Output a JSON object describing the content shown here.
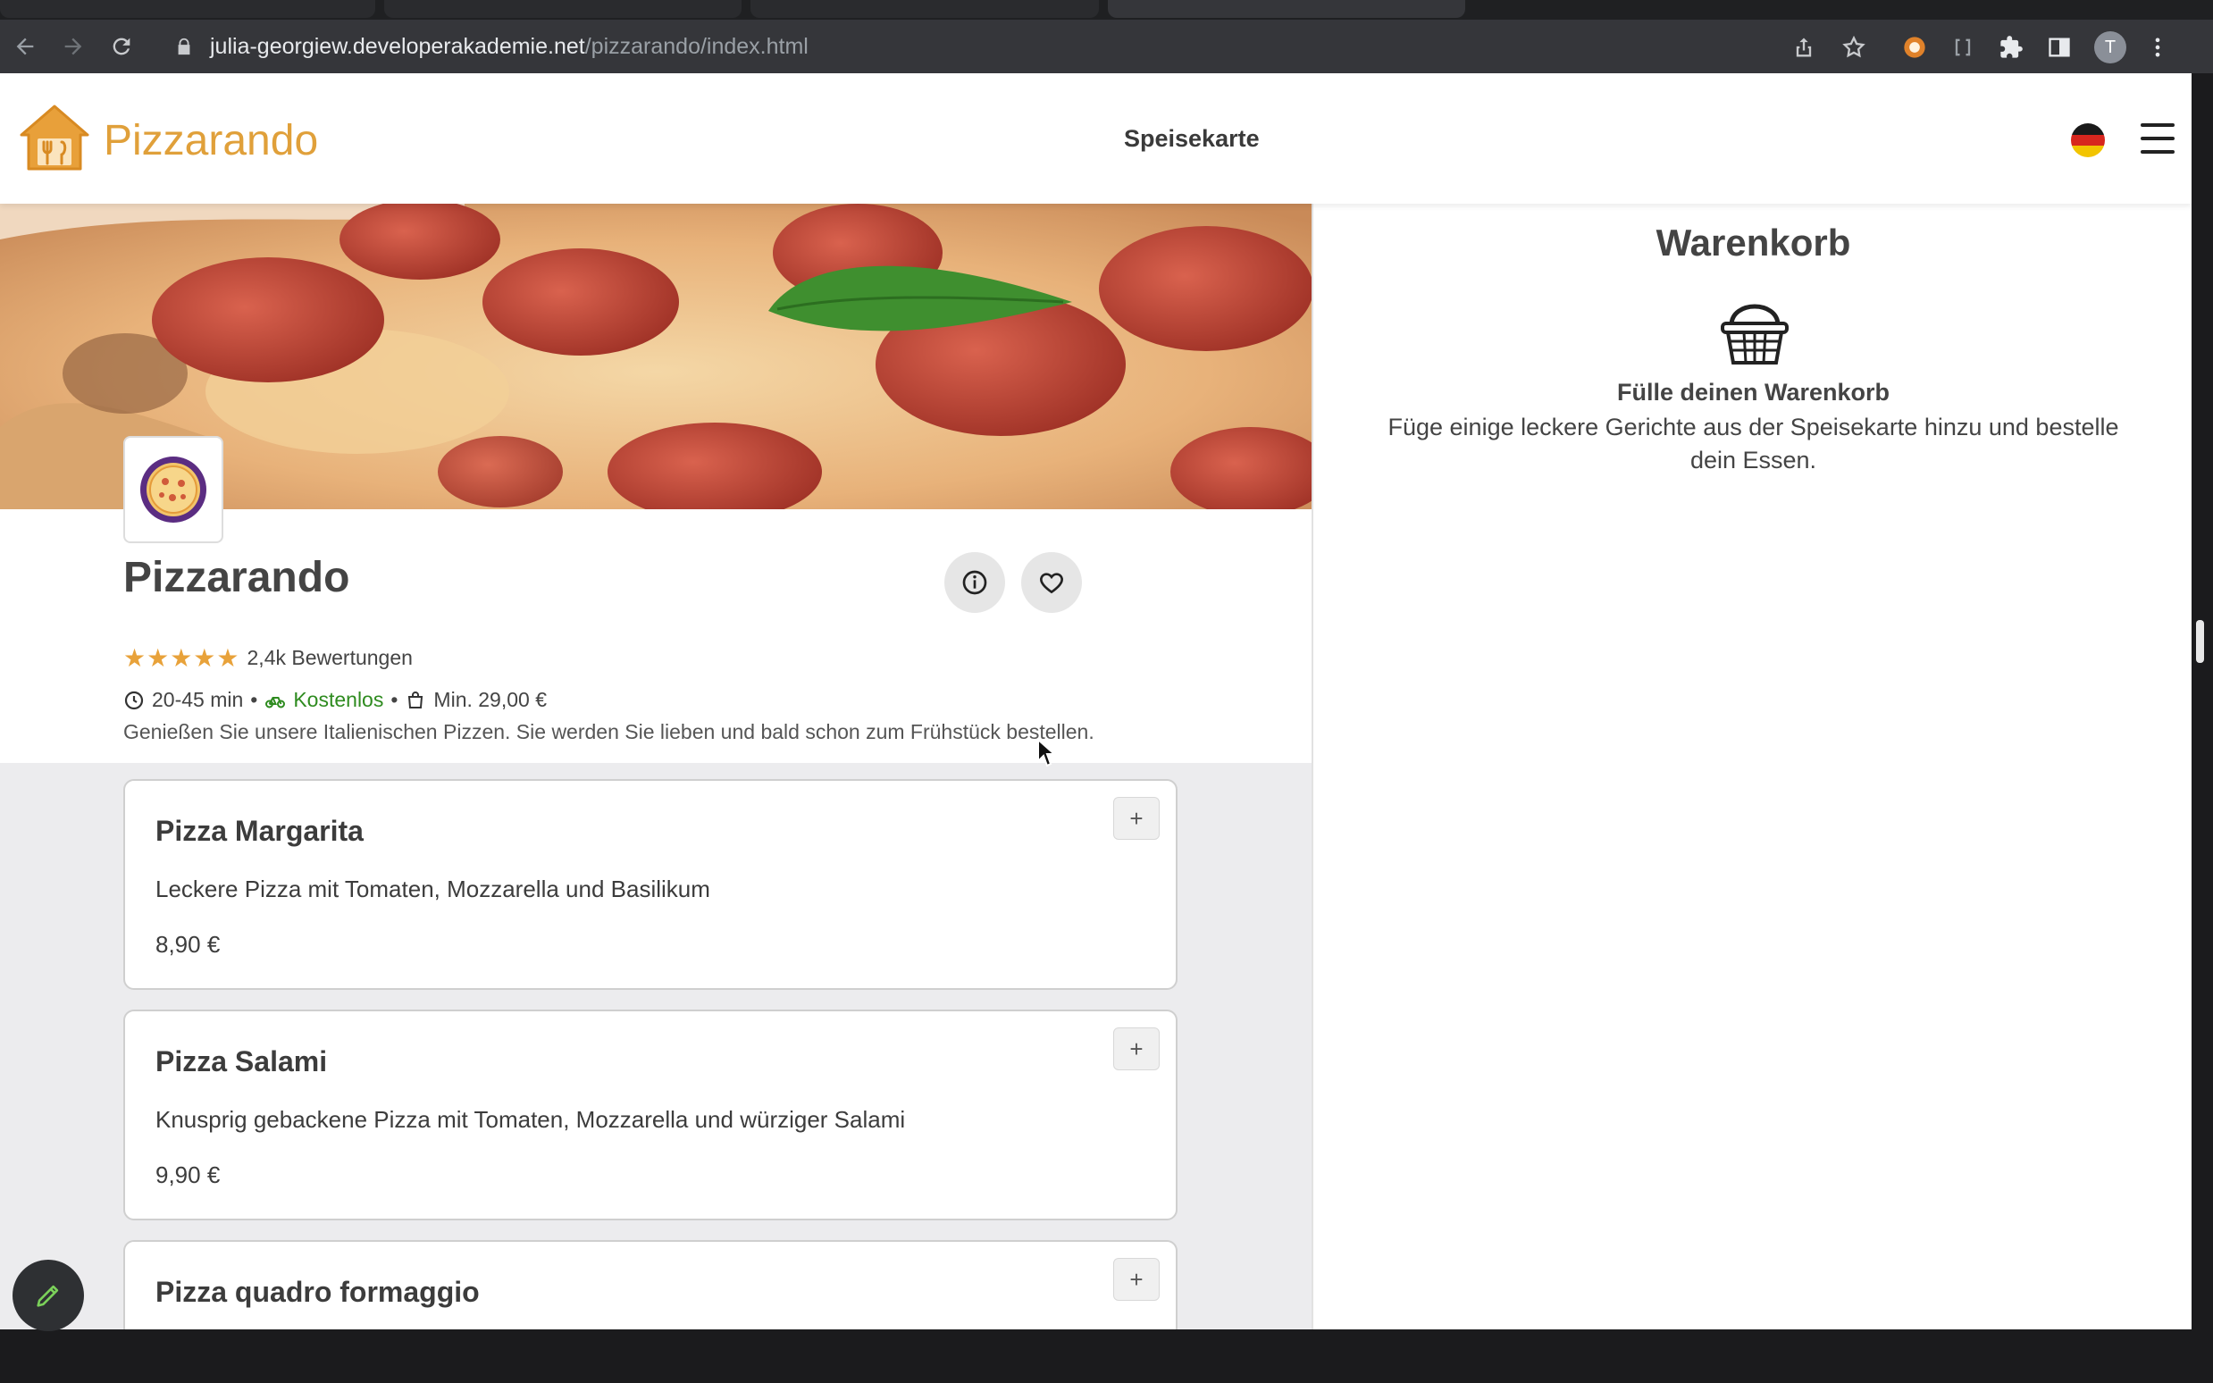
{
  "browser": {
    "url_host": "julia-georgiew.developerakademie.net",
    "url_path": "/pizzarando/index.html",
    "profile_initial": "T"
  },
  "header": {
    "brand": "Pizzarando",
    "nav_label": "Speisekarte"
  },
  "restaurant": {
    "name": "Pizzarando",
    "stars": "★★★★★",
    "reviews": "2,4k Bewertungen",
    "delivery_time": "20-45 min",
    "delivery_cost": "Kostenlos",
    "minimum_order": "Min. 29,00 €",
    "description": "Genießen Sie unsere Italienischen Pizzen. Sie werden Sie lieben und bald schon zum Frühstück bestellen."
  },
  "dishes": [
    {
      "name": "Pizza Margarita",
      "description": "Leckere Pizza mit Tomaten, Mozzarella und Basilikum",
      "price": "8,90 €",
      "add_label": "+"
    },
    {
      "name": "Pizza Salami",
      "description": "Knusprig gebackene Pizza mit Tomaten, Mozzarella und würziger Salami",
      "price": "9,90 €",
      "add_label": "+"
    },
    {
      "name": "Pizza quadro formaggio",
      "description": "",
      "price": "",
      "add_label": "+"
    }
  ],
  "cart": {
    "title": "Warenkorb",
    "empty_title": "Fülle deinen Warenkorb",
    "empty_text": "Füge einige leckere Gerichte aus der Speisekarte hinzu und bestelle dein Essen."
  },
  "colors": {
    "brand": "#e0a03a",
    "free_delivery": "#2e8b1f",
    "star": "#e8a23a"
  }
}
